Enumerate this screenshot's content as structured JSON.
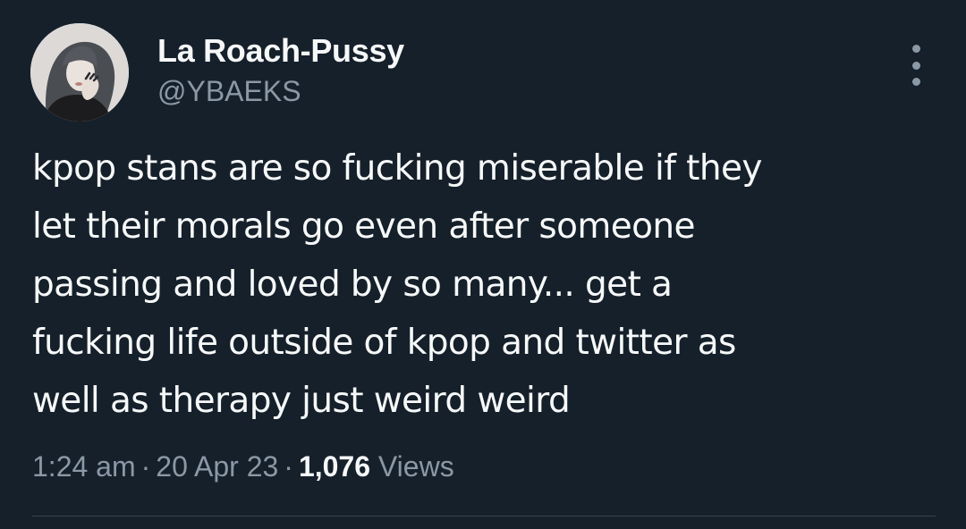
{
  "tweet": {
    "author": {
      "display_name": "La Roach-Pussy",
      "handle": "@YBAEKS",
      "avatar_icon": "profile-photo"
    },
    "text_lines": [
      "kpop stans are so fucking miserable if they",
      "let their morals go even after someone",
      "passing and loved by so many... get a",
      "fucking life outside of kpop and twitter as",
      "well as therapy just weird weird"
    ],
    "time": "1:24 am",
    "separator": "·",
    "date": "20 Apr 23",
    "views_count": "1,076",
    "views_label": "Views",
    "more_icon": "more-vertical-icon"
  },
  "colors": {
    "background": "#15202b",
    "primary_text": "#f7f9f9",
    "secondary_text": "#8b98a5",
    "divider": "#38444d"
  }
}
